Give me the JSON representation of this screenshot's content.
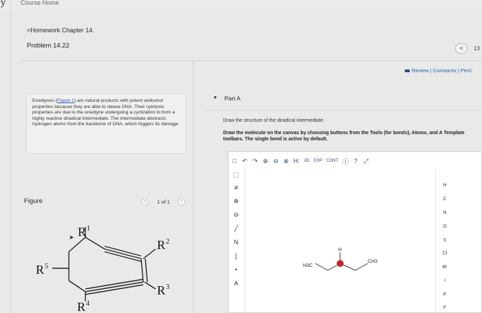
{
  "app": {
    "brand_letter": "y",
    "course_home": "Course Home"
  },
  "header": {
    "back_link": "<Homework Chapter 14.",
    "problem_title": "Problem 14.22",
    "nav_prev": "<",
    "page_indicator": "13"
  },
  "links": {
    "review": "Review",
    "sep1": "|",
    "constants": "Constants",
    "sep2": "|",
    "periodic": "Peric"
  },
  "description": {
    "part1": "Enediynes (",
    "figure_link": "Figure 1",
    "part2": ") are natural products with potent antitumor properties because they are able to cleave DNA. Their cytotoxic properties are due to the enediyne undergoing a cyclization to form a highly reactive diradical intermediate. The intermediate abstracts hydrogen atoms from the backbone of DNA, which triggers its damage."
  },
  "figure": {
    "label": "Figure",
    "prev": "<",
    "count": "1 of 1",
    "next": ">",
    "labels": {
      "r1": "R",
      "r1_sup": "1",
      "r2": "R",
      "r2_sup": "2",
      "r3": "R",
      "r3_sup": "3",
      "r4": "R",
      "r4_sup": "4",
      "r5": "R",
      "r5_sup": "5"
    }
  },
  "part_a": {
    "caret": "▼",
    "title": "Part A",
    "question": "Draw the structure of the diradical intermediate.",
    "instructions": "Draw the molecule on the canvas by choosing buttons from the Tools (for bonds), Atoms, and A Template toolbars. The single bond is active by default."
  },
  "toolbar": {
    "items": [
      "□",
      "↶",
      "↷",
      "⊕",
      "⊖",
      "⊗",
      "H:",
      "2D",
      "EXP",
      "CONT",
      "ⓘ",
      "?",
      "⤢"
    ]
  },
  "left_tools": [
    "⬚",
    "⌀",
    "⊕",
    "⊖",
    "╱",
    "N",
    "[",
    "•",
    "A"
  ],
  "atoms": [
    "H",
    "C",
    "N",
    "O",
    "S",
    "Cl",
    "Br",
    "I",
    "P",
    "F"
  ],
  "canvas": {
    "h3c": "H3C",
    "h": "H",
    "ch3": "CH3"
  },
  "colors": {
    "link": "#2a5db0",
    "accent_red": "#c62828"
  }
}
